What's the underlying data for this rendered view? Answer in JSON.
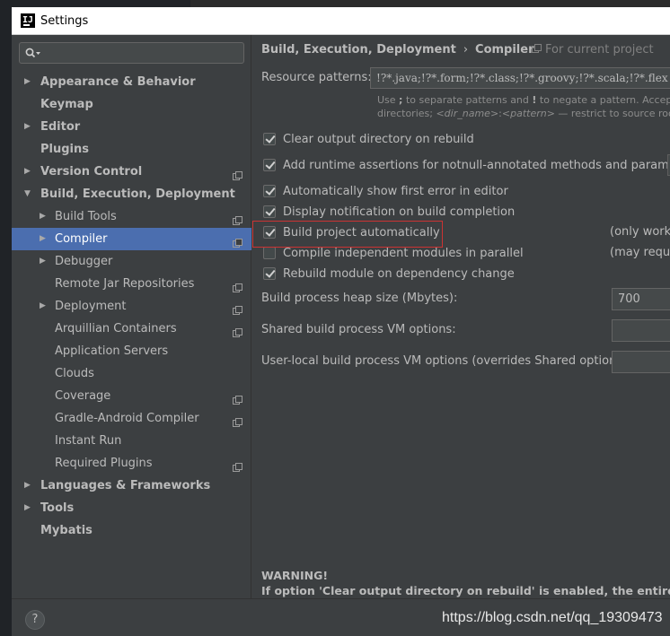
{
  "window": {
    "title": "Settings",
    "app_icon": "intellij-icon",
    "app_icon_text": "IJ"
  },
  "search": {
    "value": "",
    "icon": "search-icon"
  },
  "tree": [
    {
      "label": "Appearance & Behavior",
      "level": 0,
      "arrow": true,
      "bold": true,
      "project_icon": false,
      "selected": false,
      "expanded": false
    },
    {
      "label": "Keymap",
      "level": 0,
      "arrow": false,
      "bold": true,
      "project_icon": false,
      "selected": false
    },
    {
      "label": "Editor",
      "level": 0,
      "arrow": true,
      "bold": true,
      "project_icon": false,
      "selected": false,
      "expanded": false
    },
    {
      "label": "Plugins",
      "level": 0,
      "arrow": false,
      "bold": true,
      "project_icon": false,
      "selected": false
    },
    {
      "label": "Version Control",
      "level": 0,
      "arrow": true,
      "bold": true,
      "project_icon": true,
      "selected": false,
      "expanded": false
    },
    {
      "label": "Build, Execution, Deployment",
      "level": 0,
      "arrow": true,
      "bold": true,
      "project_icon": false,
      "selected": false,
      "expanded": true
    },
    {
      "label": "Build Tools",
      "level": 1,
      "arrow": true,
      "bold": false,
      "project_icon": true,
      "selected": false,
      "expanded": false
    },
    {
      "label": "Compiler",
      "level": 1,
      "arrow": true,
      "bold": false,
      "project_icon": true,
      "selected": true,
      "expanded": false
    },
    {
      "label": "Debugger",
      "level": 1,
      "arrow": true,
      "bold": false,
      "project_icon": false,
      "selected": false,
      "expanded": false
    },
    {
      "label": "Remote Jar Repositories",
      "level": 1,
      "arrow": false,
      "bold": false,
      "project_icon": true,
      "selected": false
    },
    {
      "label": "Deployment",
      "level": 1,
      "arrow": true,
      "bold": false,
      "project_icon": true,
      "selected": false,
      "expanded": false
    },
    {
      "label": "Arquillian Containers",
      "level": 1,
      "arrow": false,
      "bold": false,
      "project_icon": true,
      "selected": false
    },
    {
      "label": "Application Servers",
      "level": 1,
      "arrow": false,
      "bold": false,
      "project_icon": false,
      "selected": false
    },
    {
      "label": "Clouds",
      "level": 1,
      "arrow": false,
      "bold": false,
      "project_icon": false,
      "selected": false
    },
    {
      "label": "Coverage",
      "level": 1,
      "arrow": false,
      "bold": false,
      "project_icon": true,
      "selected": false
    },
    {
      "label": "Gradle-Android Compiler",
      "level": 1,
      "arrow": false,
      "bold": false,
      "project_icon": true,
      "selected": false
    },
    {
      "label": "Instant Run",
      "level": 1,
      "arrow": false,
      "bold": false,
      "project_icon": false,
      "selected": false
    },
    {
      "label": "Required Plugins",
      "level": 1,
      "arrow": false,
      "bold": false,
      "project_icon": true,
      "selected": false
    },
    {
      "label": "Languages & Frameworks",
      "level": 0,
      "arrow": true,
      "bold": true,
      "project_icon": false,
      "selected": false,
      "expanded": false
    },
    {
      "label": "Tools",
      "level": 0,
      "arrow": true,
      "bold": true,
      "project_icon": false,
      "selected": false,
      "expanded": false
    },
    {
      "label": "Mybatis",
      "level": 0,
      "arrow": false,
      "bold": true,
      "project_icon": false,
      "selected": false
    }
  ],
  "breadcrumb": {
    "parent": "Build, Execution, Deployment",
    "separator": "›",
    "current": "Compiler"
  },
  "scope": {
    "label": "For current project",
    "icon": "project-scope-icon"
  },
  "resource_patterns": {
    "label": "Resource patterns:",
    "value": "!?*.java;!?*.form;!?*.class;!?*.groovy;!?*.scala;!?*.flex",
    "hint_1": "Use ; to separate patterns and ! to negate a pattern. Accepted wildcards:",
    "hint_2": "directories; <dir_name>:<pattern> — restrict to source roots with the specified name"
  },
  "checkboxes": [
    {
      "label": "Clear output directory on rebuild",
      "checked": true
    },
    {
      "label": "Add runtime assertions for notnull-annotated methods and parameters",
      "checked": true
    },
    {
      "label": "Automatically show first error in editor",
      "checked": true
    },
    {
      "label": "Display notification on build completion",
      "checked": true
    },
    {
      "label": "Build project automatically",
      "checked": true,
      "note": "(only works while not running / debugging)"
    },
    {
      "label": "Compile independent modules in parallel",
      "checked": false,
      "note": "(may require larger heap size)"
    },
    {
      "label": "Rebuild module on dependency change",
      "checked": true
    }
  ],
  "fields": {
    "heap_label": "Build process heap size (Mbytes):",
    "heap_value": "700",
    "shared_label": "Shared build process VM options:",
    "shared_value": "",
    "user_label": "User-local build process VM options (overrides Shared options):",
    "user_value": ""
  },
  "warning": {
    "title": "WARNING!",
    "text": "If option 'Clear output directory on rebuild' is enabled, the entire contents of output directories will be cleared on rebuild."
  },
  "bottom": {
    "help": "?",
    "watermark": "https://blog.csdn.net/qq_19309473"
  },
  "colors": {
    "selection": "#4b6eaf",
    "panel": "#3c3f41",
    "highlight_box": "#cc3333"
  }
}
